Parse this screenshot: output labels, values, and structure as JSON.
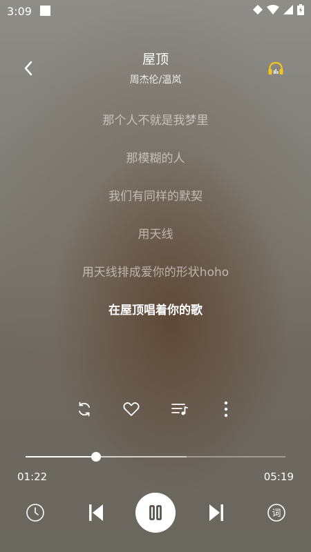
{
  "status": {
    "time": "3:09"
  },
  "header": {
    "title": "屋顶",
    "artist": "周杰伦/温岚"
  },
  "lyrics": [
    "那个人不就是我梦里",
    "那模糊的人",
    "我们有同样的默契",
    "用天线",
    "用天线排成爱你的形状hoho",
    "在屋顶唱着你的歌"
  ],
  "active_lyric_index": 5,
  "player": {
    "current_time": "01:22",
    "total_time": "05:19",
    "progress_fraction": 0.27,
    "buffered_fraction": 0.62,
    "state": "playing"
  },
  "icons": {
    "back": "chevron-left-icon",
    "headphone": "headphones-icon",
    "repeat": "repeat-icon",
    "like": "heart-icon",
    "playlist": "playlist-icon",
    "more": "more-vertical-icon",
    "sleep_timer": "clock-icon",
    "previous": "skip-previous-icon",
    "pause": "pause-icon",
    "next": "skip-next-icon",
    "lyric_toggle": "lyric-icon"
  },
  "colors": {
    "accent_headphone": "#f5c518"
  },
  "lyric_button_glyph": "词"
}
